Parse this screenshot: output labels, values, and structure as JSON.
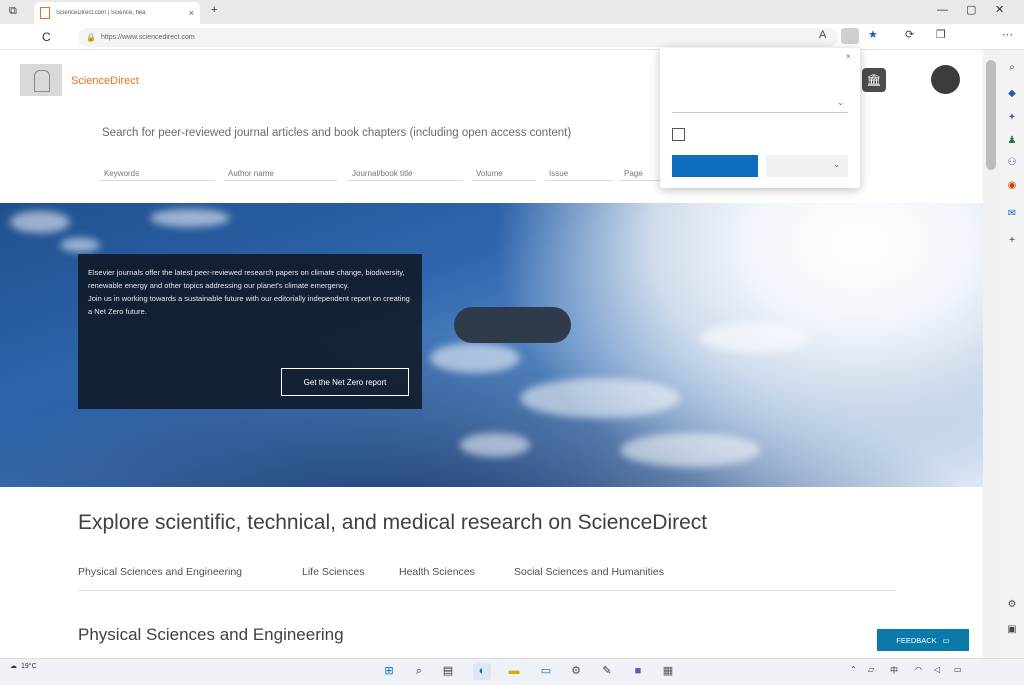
{
  "browser": {
    "tab_title": "ScienceDirect.com | Science, hea",
    "tab_close": "×",
    "new_tab": "+",
    "window_icon": "⧉",
    "url": "https://www.sciencedirect.com",
    "lock": "🔒",
    "refresh": "C"
  },
  "site": {
    "brand": "ScienceDirect",
    "account_label": "",
    "avatar_initials": "",
    "institution_icon": "🏛"
  },
  "search": {
    "lead": "Search for peer-reviewed journal articles and book chapters (including open access content)",
    "fields": [
      {
        "placeholder": "Keywords"
      },
      {
        "placeholder": "Author name"
      },
      {
        "placeholder": "Journal/book title"
      },
      {
        "placeholder": "Volume"
      },
      {
        "placeholder": "Issue"
      },
      {
        "placeholder": "Page"
      }
    ]
  },
  "hero": {
    "promo_text": "Elsevier journals offer the latest peer-reviewed research papers on climate change, biodiversity, renewable energy and other topics addressing our planet's climate emergency.",
    "promo_text_2": "Join us in working towards a sustainable future with our editorially independent report on creating a Net Zero future.",
    "promo_button": "Get the Net Zero report",
    "pill_label": ""
  },
  "explore": {
    "title": "Explore scientific, technical, and medical research on ScienceDirect",
    "categories": [
      "Physical Sciences and Engineering",
      "Life Sciences",
      "Health Sciences",
      "Social Sciences and Humanities"
    ],
    "section_title": "Physical Sciences and Engineering",
    "feedback": "FEEDBACK"
  },
  "translate_popup": {
    "title": "",
    "close": "×",
    "label": "",
    "selected": "",
    "checkbox_label": "",
    "primary": "",
    "secondary": ""
  },
  "taskbar": {
    "weather": "19°C",
    "time": "",
    "date": ""
  },
  "colors": {
    "brand": "#e9711c",
    "primary_blue": "#0f6cbd",
    "feedback": "#0b7aab"
  }
}
